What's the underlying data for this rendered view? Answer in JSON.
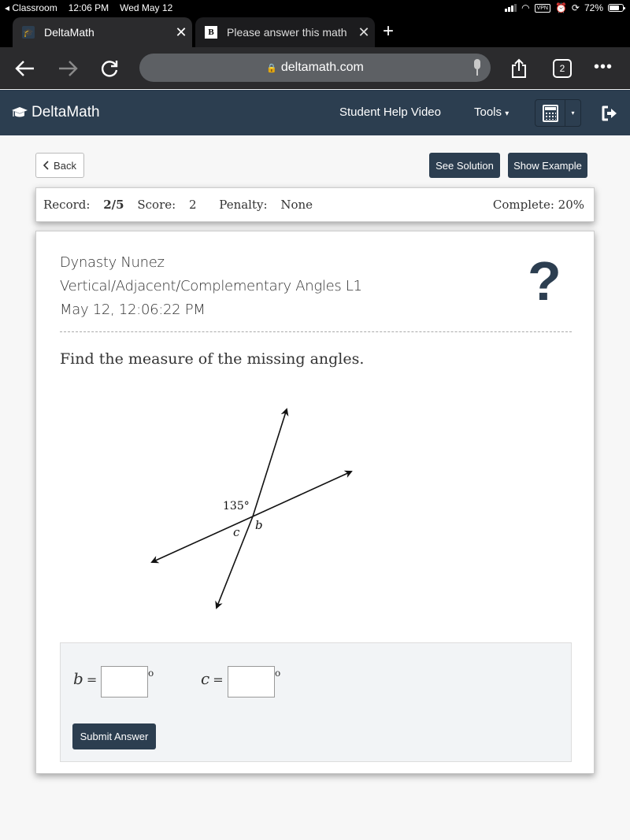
{
  "status_bar": {
    "back_app": "Classroom",
    "time": "12:06 PM",
    "date": "Wed May 12",
    "vpn": "VPN",
    "battery": "72%",
    "battery_level": 0.72
  },
  "browser": {
    "tabs": [
      {
        "title": "DeltaMath",
        "favicon": "graduation-cap",
        "active": true
      },
      {
        "title": "Please answer this math",
        "favicon": "B",
        "active": false
      }
    ],
    "new_tab": "+",
    "close": "✕",
    "url": "deltamath.com",
    "tab_count": "2",
    "more": "•••"
  },
  "navbar": {
    "brand": "DeltaMath",
    "help_video": "Student Help Video",
    "tools": "Tools",
    "tools_caret": "▾",
    "calc_caret": "▾"
  },
  "actions": {
    "back": "Back",
    "see_solution": "See Solution",
    "show_example": "Show Example"
  },
  "record": {
    "record_label": "Record:",
    "record_value": "2/5",
    "score_label": "Score:",
    "score_value": "2",
    "penalty_label": "Penalty:",
    "penalty_value": "None",
    "complete_label": "Complete:",
    "complete_value": "20%"
  },
  "problem": {
    "student": "Dynasty Nunez",
    "skill": "Vertical/Adjacent/Complementary Angles L1",
    "timestamp": "May 12, 12:06:22 PM",
    "help_icon": "?",
    "prompt": "Find the measure of the missing angles.",
    "diagram": {
      "given_angle": "135°",
      "label_b": "b",
      "label_c": "c"
    }
  },
  "answer": {
    "b_label": "b",
    "c_label": "c",
    "equals": "=",
    "degree": "o",
    "b_value": "",
    "c_value": "",
    "submit": "Submit Answer"
  }
}
